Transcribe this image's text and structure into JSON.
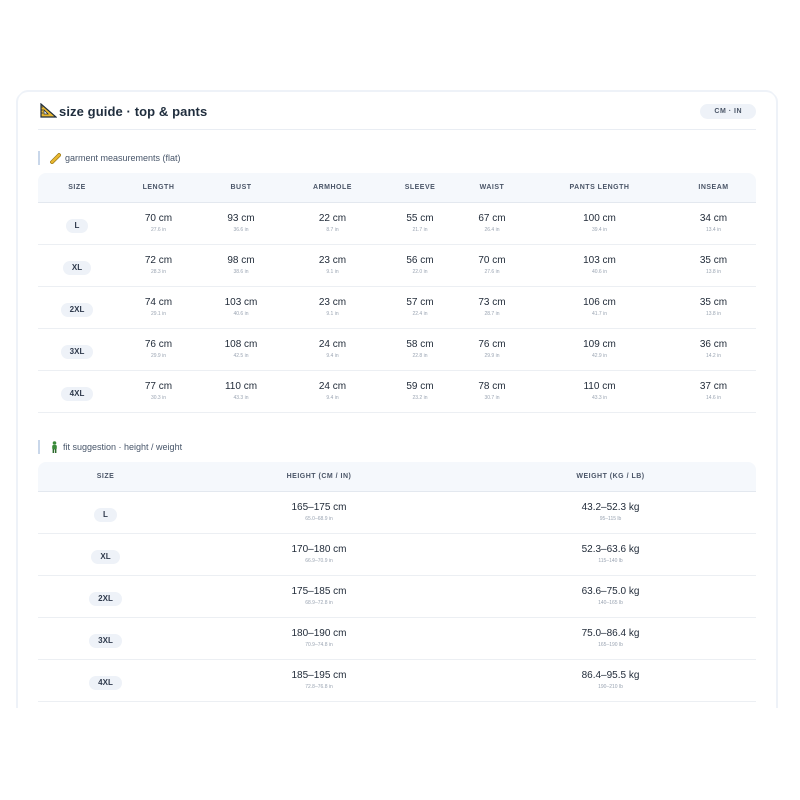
{
  "header": {
    "title": "size guide · top & pants",
    "unit_toggle": "CM · IN"
  },
  "garment": {
    "label": "garment measurements (flat)",
    "columns": [
      "SIZE",
      "LENGTH",
      "BUST",
      "ARMHOLE",
      "SLEEVE",
      "WAIST",
      "PANTS LENGTH",
      "INSEAM"
    ],
    "rows": [
      {
        "size": "L",
        "cells": [
          [
            "70 cm",
            "27.6 in"
          ],
          [
            "93 cm",
            "36.6 in"
          ],
          [
            "22 cm",
            "8.7 in"
          ],
          [
            "55 cm",
            "21.7 in"
          ],
          [
            "67 cm",
            "26.4 in"
          ],
          [
            "100 cm",
            "39.4 in"
          ],
          [
            "34 cm",
            "13.4 in"
          ]
        ]
      },
      {
        "size": "XL",
        "cells": [
          [
            "72 cm",
            "28.3 in"
          ],
          [
            "98 cm",
            "38.6 in"
          ],
          [
            "23 cm",
            "9.1 in"
          ],
          [
            "56 cm",
            "22.0 in"
          ],
          [
            "70 cm",
            "27.6 in"
          ],
          [
            "103 cm",
            "40.6 in"
          ],
          [
            "35 cm",
            "13.8 in"
          ]
        ]
      },
      {
        "size": "2XL",
        "cells": [
          [
            "74 cm",
            "29.1 in"
          ],
          [
            "103 cm",
            "40.6 in"
          ],
          [
            "23 cm",
            "9.1 in"
          ],
          [
            "57 cm",
            "22.4 in"
          ],
          [
            "73 cm",
            "28.7 in"
          ],
          [
            "106 cm",
            "41.7 in"
          ],
          [
            "35 cm",
            "13.8 in"
          ]
        ]
      },
      {
        "size": "3XL",
        "cells": [
          [
            "76 cm",
            "29.9 in"
          ],
          [
            "108 cm",
            "42.5 in"
          ],
          [
            "24 cm",
            "9.4 in"
          ],
          [
            "58 cm",
            "22.8 in"
          ],
          [
            "76 cm",
            "29.9 in"
          ],
          [
            "109 cm",
            "42.9 in"
          ],
          [
            "36 cm",
            "14.2 in"
          ]
        ]
      },
      {
        "size": "4XL",
        "cells": [
          [
            "77 cm",
            "30.3 in"
          ],
          [
            "110 cm",
            "43.3 in"
          ],
          [
            "24 cm",
            "9.4 in"
          ],
          [
            "59 cm",
            "23.2 in"
          ],
          [
            "78 cm",
            "30.7 in"
          ],
          [
            "110 cm",
            "43.3 in"
          ],
          [
            "37 cm",
            "14.6 in"
          ]
        ]
      }
    ]
  },
  "fit": {
    "label": "fit suggestion · height / weight",
    "columns": [
      "SIZE",
      "HEIGHT (CM / IN)",
      "WEIGHT (KG / LB)"
    ],
    "rows": [
      {
        "size": "L",
        "cells": [
          [
            "165–175 cm",
            "65.0–68.9 in"
          ],
          [
            "43.2–52.3 kg",
            "95–115 lb"
          ]
        ]
      },
      {
        "size": "XL",
        "cells": [
          [
            "170–180 cm",
            "66.9–70.9 in"
          ],
          [
            "52.3–63.6 kg",
            "115–140 lb"
          ]
        ]
      },
      {
        "size": "2XL",
        "cells": [
          [
            "175–185 cm",
            "68.9–72.8 in"
          ],
          [
            "63.6–75.0 kg",
            "140–165 lb"
          ]
        ]
      },
      {
        "size": "3XL",
        "cells": [
          [
            "180–190 cm",
            "70.9–74.8 in"
          ],
          [
            "75.0–86.4 kg",
            "165–190 lb"
          ]
        ]
      },
      {
        "size": "4XL",
        "cells": [
          [
            "185–195 cm",
            "72.8–76.8 in"
          ],
          [
            "86.4–95.5 kg",
            "190–210 lb"
          ]
        ]
      }
    ]
  },
  "icons": {
    "title": "triangle-ruler-icon",
    "garment": "ruler-icon",
    "fit": "person-icon"
  },
  "colors": {
    "pill_bg": "#eef2f8",
    "header_bg": "#f5f8fc",
    "ruler_yellow": "#e8b730",
    "person_green": "#3a8a3a"
  }
}
